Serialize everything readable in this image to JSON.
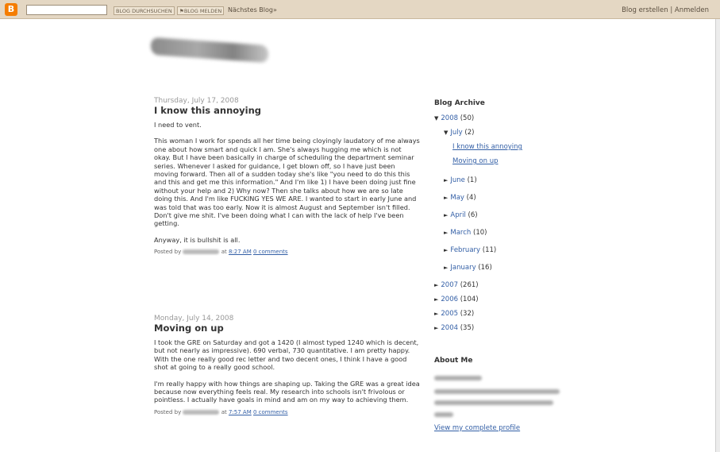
{
  "navbar": {
    "logo_letter": "B",
    "search_button": "BLOG DURCHSUCHEN",
    "flag_button": "⚑BLOG MELDEN",
    "next_blog": "Nächstes Blog»",
    "create_blog": "Blog erstellen",
    "separator": "|",
    "sign_in": "Anmelden"
  },
  "posts": [
    {
      "date": "Thursday, July 17, 2008",
      "title": "I know this annoying",
      "paragraphs": [
        "I need to vent.",
        "This woman I work for spends all her time being cloyingly laudatory of me always one about how smart and quick I am. She's always hugging me which is not okay. But I have been basically in charge of scheduling the department seminar series. Whenever I asked for guidance, I get blown off, so I have just been moving forward. Then all of a sudden today she's like \"you need to do this this and this and get me this information.\" And I'm like 1) I have been doing just fine without your help and 2) Why now? Then she talks about how we are so late doing this. And I'm like FUCKING YES WE ARE. I wanted to start in early June and was told that was too early. Now it is almost August and September isn't filled. Don't give me shit. I've been doing what I can with the lack of help I've been getting.",
        "Anyway, it is bullshit is all."
      ],
      "posted_by": "Posted by",
      "at": "at",
      "time": "8:27 AM",
      "comments": "0 comments"
    },
    {
      "date": "Monday, July 14, 2008",
      "title": "Moving on up",
      "paragraphs": [
        "I took the GRE on Saturday and got a 1420 (I almost typed 1240 which is decent, but not nearly as impressive). 690 verbal, 730 quantitative. I am pretty happy. With the one really good rec letter and two decent ones, I think I have a good shot at going to a really good school.",
        "I'm really happy with how things are shaping up. Taking the GRE was a great idea because now everything feels real. My research into schools isn't frivolous or pointless. I actually have goals in mind and am on my way to achieving them."
      ],
      "posted_by": "Posted by",
      "at": "at",
      "time": "7:57 AM",
      "comments": "0 comments"
    }
  ],
  "sidebar": {
    "archive_title": "Blog Archive",
    "year_2008": {
      "label": "2008",
      "count": "(50)"
    },
    "july": {
      "label": "July",
      "count": "(2)"
    },
    "july_posts": [
      "I know this annoying",
      "Moving on up"
    ],
    "months": [
      {
        "label": "June",
        "count": "(1)"
      },
      {
        "label": "May",
        "count": "(4)"
      },
      {
        "label": "April",
        "count": "(6)"
      },
      {
        "label": "March",
        "count": "(10)"
      },
      {
        "label": "February",
        "count": "(11)"
      },
      {
        "label": "January",
        "count": "(16)"
      }
    ],
    "years": [
      {
        "label": "2007",
        "count": "(261)"
      },
      {
        "label": "2006",
        "count": "(104)"
      },
      {
        "label": "2005",
        "count": "(32)"
      },
      {
        "label": "2004",
        "count": "(35)"
      }
    ],
    "about_title": "About Me",
    "profile_link": "View my complete profile"
  },
  "icons": {
    "expanded": "▼",
    "collapsed": "►"
  }
}
